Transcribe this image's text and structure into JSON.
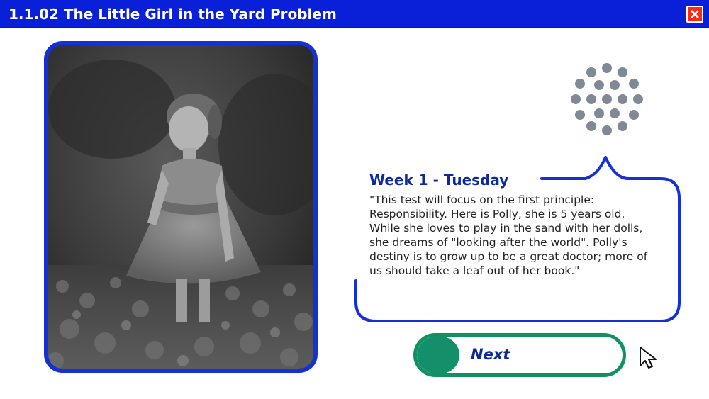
{
  "window": {
    "title": "1.1.02 The Little Girl in the Yard Problem",
    "close_icon": "close-icon",
    "accent_color": "#0a1fd8",
    "close_color": "#ff2a16"
  },
  "photo": {
    "description_icon": "photo-girl-in-field"
  },
  "spinner": {
    "icon": "loading-dots-icon",
    "color": "#808a96"
  },
  "bubble": {
    "heading": "Week 1 - Tuesday",
    "text": "\"This test will focus on the first principle: Responsibility. Here is Polly, she is 5 years old. While she loves to play in the sand with her dolls, she dreams of \"looking after the world\". Polly's destiny is to grow up to be a great doctor; more of us should take a leaf out of her book.\"",
    "border_color": "#1430d6"
  },
  "next_button": {
    "label": "Next",
    "color": "#13906a"
  },
  "cursor": {
    "icon": "mouse-pointer-icon"
  }
}
